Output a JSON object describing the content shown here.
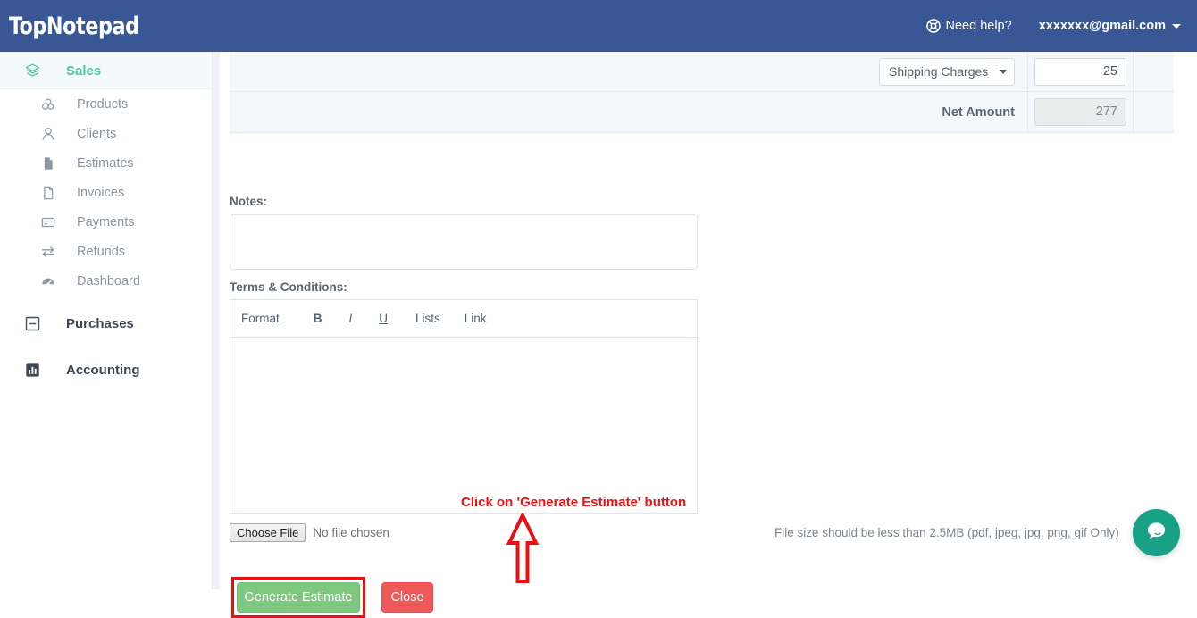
{
  "app": {
    "logo_text": "TopNotepad",
    "header": {
      "help_label": "Need help?",
      "help_icon": "lifebuoy-icon",
      "account_email": "xxxxxxx@gmail.com",
      "caret_icon": "caret-down-icon"
    },
    "colors": {
      "header_blue": "#3a5795",
      "accent_teal": "#4ec5a8",
      "chat_teal": "#19a188",
      "annotation_red": "#ee1111",
      "generate_green": "#7ec97f",
      "close_red": "#ee5a5a"
    }
  },
  "sidebar": {
    "groups": [
      {
        "label": "Sales",
        "icon": "layers-icon",
        "active": true,
        "items": [
          {
            "label": "Products",
            "icon": "products-icon"
          },
          {
            "label": "Clients",
            "icon": "user-icon"
          },
          {
            "label": "Estimates",
            "icon": "document-filled-icon"
          },
          {
            "label": "Invoices",
            "icon": "document-outline-icon"
          },
          {
            "label": "Payments",
            "icon": "credit-card-icon"
          },
          {
            "label": "Refunds",
            "icon": "exchange-arrows-icon"
          },
          {
            "label": "Dashboard",
            "icon": "gauge-icon"
          }
        ]
      },
      {
        "label": "Purchases",
        "icon": "minus-box-icon",
        "active": false,
        "items": []
      },
      {
        "label": "Accounting",
        "icon": "bar-chart-icon",
        "active": false,
        "items": []
      }
    ]
  },
  "main": {
    "totals": [
      {
        "type": "select",
        "select_value": "Shipping Charges",
        "select_caret": "caret-down-icon",
        "amount": "25",
        "readonly": false
      },
      {
        "type": "label",
        "label": "Net Amount",
        "amount": "277",
        "readonly": true
      }
    ],
    "notes": {
      "label": "Notes:",
      "value": "",
      "placeholder": ""
    },
    "terms": {
      "label": "Terms & Conditions:",
      "toolbar": {
        "format": "Format",
        "bold": "B",
        "italic": "I",
        "underline": "U",
        "lists": "Lists",
        "link": "Link"
      },
      "value": ""
    },
    "annotation": {
      "text": "Click on 'Generate Estimate'  button",
      "arrow_icon": "up-arrow-annotation-icon"
    },
    "attachment": {
      "choose_label": "Choose File",
      "status": "No file chosen",
      "hint": "File size should be less than 2.5MB (pdf, jpeg, jpg, png, gif Only)"
    },
    "actions": {
      "generate_label": "Generate Estimate",
      "close_label": "Close"
    }
  },
  "chat": {
    "icon": "chat-bubble-icon"
  }
}
